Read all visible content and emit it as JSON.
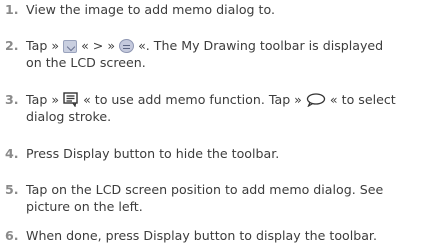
{
  "steps": [
    {
      "num": "1.",
      "line1": "View the image to add memo dialog to.",
      "line2": ""
    },
    {
      "num": "2.",
      "before": "Tap »",
      "mid": "« > »",
      "after": "«. The My Drawing toolbar is displayed",
      "line2": "on the LCD screen.",
      "icons": [
        "drawing-tools-icon",
        "memo-bubble-icon"
      ]
    },
    {
      "num": "3.",
      "before": "Tap »",
      "after1": "« to use add memo function. Tap »",
      "after2": "« to select",
      "line2": "dialog stroke.",
      "icons": [
        "memo-text-icon",
        "dialog-stroke-icon"
      ]
    },
    {
      "num": "4.",
      "line1": "Press Display button to hide the toolbar.",
      "line2": ""
    },
    {
      "num": "5.",
      "line1": "Tap on the LCD screen position to add memo dialog. See",
      "line2": "picture on the left."
    },
    {
      "num": "6.",
      "line1": "When done, press Display button to display the toolbar.",
      "line2": ""
    }
  ]
}
